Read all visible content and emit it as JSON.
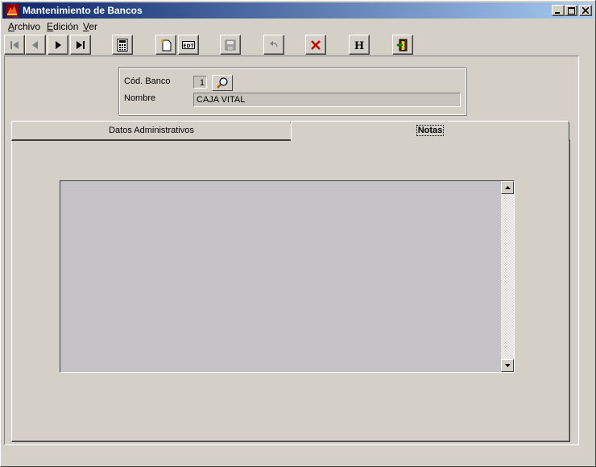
{
  "window": {
    "title": "Mantenimiento de Bancos",
    "controls": [
      "minimize-icon",
      "maximize-icon",
      "close-icon"
    ]
  },
  "menu": {
    "items": [
      {
        "label_u": "A",
        "label_rest": "rchivo"
      },
      {
        "label_u": "E",
        "label_rest": "dición"
      },
      {
        "label_u": "V",
        "label_rest": "er"
      }
    ]
  },
  "toolbar": {
    "buttons": [
      "first-record-icon",
      "previous-record-icon",
      "next-record-icon",
      "last-record-icon",
      "calculator-icon",
      "new-record-icon",
      "edit-record-icon",
      "save-icon",
      "undo-icon",
      "delete-icon",
      "history-icon",
      "exit-icon"
    ]
  },
  "form": {
    "code_label": "Cód. Banco",
    "code_value": "1",
    "name_label": "Nombre",
    "name_value": "CAJA VITAL"
  },
  "tabs": [
    {
      "label": "Datos Administrativos",
      "active": false
    },
    {
      "label": "Notas",
      "active": true
    }
  ],
  "notes": {
    "text": ""
  },
  "colors": {
    "face": "#d4d0c8",
    "title_start": "#0a246a",
    "title_end": "#a6caf0",
    "delete_red": "#cc0000"
  }
}
